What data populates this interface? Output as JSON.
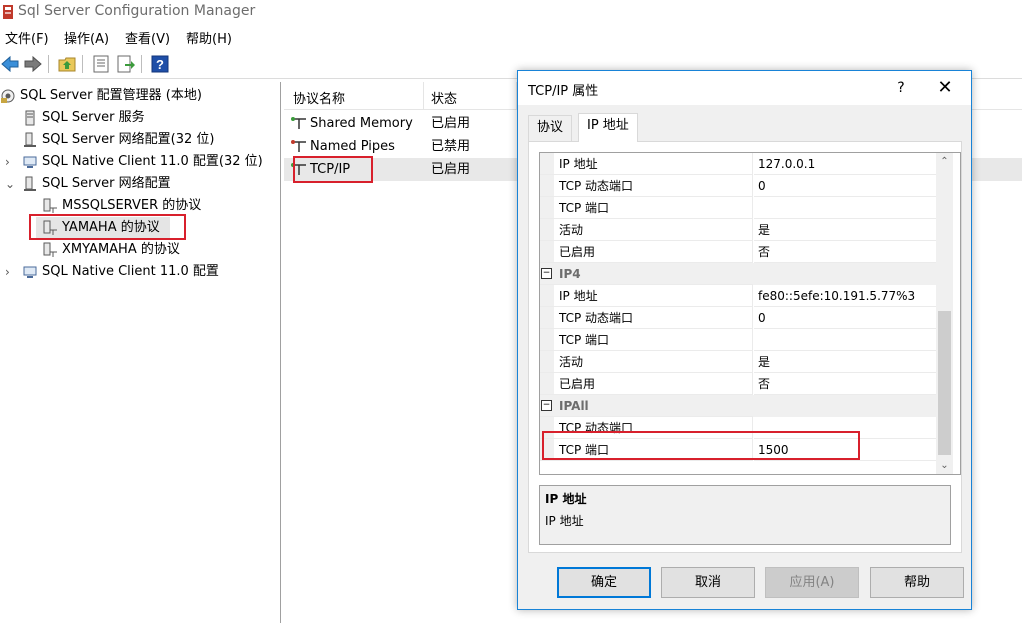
{
  "app": {
    "title": "Sql Server Configuration Manager"
  },
  "menu": [
    {
      "label": "文件(F)"
    },
    {
      "label": "操作(A)"
    },
    {
      "label": "查看(V)"
    },
    {
      "label": "帮助(H)"
    }
  ],
  "toolbar": {
    "buttons": [
      "back-arrow-icon",
      "forward-arrow-icon",
      "up-folder-icon",
      "properties-icon",
      "export-icon",
      "help-icon"
    ]
  },
  "tree": {
    "root": "SQL Server 配置管理器 (本地)",
    "items": [
      {
        "label": "SQL Server 服务"
      },
      {
        "label": "SQL Server 网络配置(32 位)"
      },
      {
        "label": "SQL Native Client 11.0 配置(32 位)"
      },
      {
        "label": "SQL Server 网络配置"
      },
      {
        "label": "MSSQLSERVER 的协议"
      },
      {
        "label": "YAMAHA 的协议"
      },
      {
        "label": "XMYAMAHA 的协议"
      },
      {
        "label": "SQL Native Client 11.0 配置"
      }
    ]
  },
  "list": {
    "headers": {
      "name": "协议名称",
      "status": "状态"
    },
    "rows": [
      {
        "name": "Shared Memory",
        "status": "已启用"
      },
      {
        "name": "Named Pipes",
        "status": "已禁用"
      },
      {
        "name": "TCP/IP",
        "status": "已启用"
      }
    ]
  },
  "dialog": {
    "title": "TCP/IP 属性",
    "help_glyph": "?",
    "close_glyph": "✕",
    "tabs": [
      {
        "label": "协议"
      },
      {
        "label": "IP 地址"
      }
    ],
    "grid": [
      {
        "type": "prop",
        "name": "IP 地址",
        "value": "127.0.0.1"
      },
      {
        "type": "prop",
        "name": "TCP 动态端口",
        "value": "0"
      },
      {
        "type": "prop",
        "name": "TCP 端口",
        "value": ""
      },
      {
        "type": "prop",
        "name": "活动",
        "value": "是"
      },
      {
        "type": "prop",
        "name": "已启用",
        "value": "否"
      },
      {
        "type": "cat",
        "name": "IP4",
        "expander": "−"
      },
      {
        "type": "prop",
        "name": "IP 地址",
        "value": "fe80::5efe:10.191.5.77%3"
      },
      {
        "type": "prop",
        "name": "TCP 动态端口",
        "value": "0"
      },
      {
        "type": "prop",
        "name": "TCP 端口",
        "value": ""
      },
      {
        "type": "prop",
        "name": "活动",
        "value": "是"
      },
      {
        "type": "prop",
        "name": "已启用",
        "value": "否"
      },
      {
        "type": "cat",
        "name": "IPAll",
        "expander": "−"
      },
      {
        "type": "prop",
        "name": "TCP 动态端口",
        "value": ""
      },
      {
        "type": "prop",
        "name": "TCP 端口",
        "value": "1500"
      }
    ],
    "scroll": {
      "up": "⌃",
      "down": "⌄"
    },
    "description": {
      "title": "IP 地址",
      "text": "IP 地址"
    },
    "buttons": {
      "ok": "确定",
      "cancel": "取消",
      "apply": "应用(A)",
      "help": "帮助"
    }
  }
}
